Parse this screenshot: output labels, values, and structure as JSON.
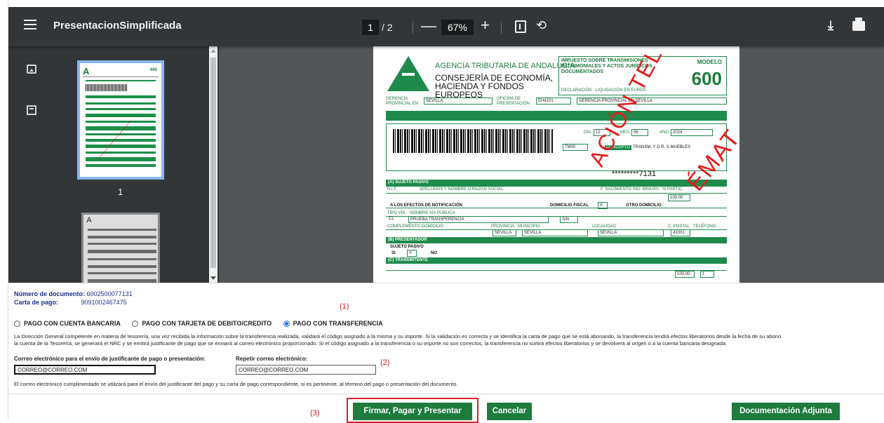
{
  "viewer": {
    "title": "PresentacionSimplificada",
    "page_current": "1",
    "page_total": "/ 2",
    "zoom": "67%",
    "minus": "—",
    "plus": "+",
    "rotate": "⟲",
    "download": "⤓",
    "thumb1_label": "1",
    "thumb_logo": "A",
    "thumb_model": "600"
  },
  "document": {
    "agency": "AGENCIA TRIBUTARIA DE ANDALUCÍA",
    "consejeria": "CONSEJERÍA DE ECONOMÍA, HACIENDA Y FONDOS EUROPEOS",
    "tax_title": "IMPUESTO SOBRE TRANSMISIONES PATRIMONIALES Y ACTOS JURÍDICOS DOCUMENTADOS",
    "modelo_label": "MODELO",
    "modelo": "600",
    "declaracion": "DECLARACIÓN - LIQUIDACIÓN EN EUROS",
    "gerencia_label": "GERENCIA PROVINCIAL EN",
    "gerencia": "SEVILLA",
    "oficina_label": "OFICINA DE PRESENTACIÓN",
    "oficina": "EH4101",
    "gerencia_desc": "GERENCIA PROVINCIAL EN SEVILLA",
    "dia_label": "DÍA",
    "dia": "12",
    "mes_label": "MES",
    "mes": "06",
    "anio_label": "AÑO",
    "anio": "2024",
    "tm": "TM00",
    "concepto_label": "CONCEPTO",
    "concepto": "TRANSM. Y D.R. S MUEBLES",
    "masked": "*********7131",
    "sec_a": "(A) SUJETO PASIVO",
    "nif_label": "N.I.F.",
    "apellidos_label": "APELLIDOS Y NOMBRE O RAZÓN SOCIAL",
    "nacimiento_label": "F. NACIMIENTO",
    "minusv_label": "IND. MINUSV.",
    "partic_label": "% PARTIC.",
    "partic": "100,00",
    "notif_label": "A LOS EFECTOS DE NOTIFICACIÓN",
    "domfiscal_label": "DOMICILIO FISCAL",
    "domfiscal": "X",
    "otrodom_label": "OTRO DOMICILIO",
    "tipovia_label": "TIPO VÍA",
    "tipovia": "CL",
    "via_label": "NOMBRE VÍA PÚBLICA",
    "via": "PRUEBA TRANSFERENCIA",
    "numero": "S/N",
    "complemento_label": "COMPLEMENTO DOMICILIO",
    "provincia_label": "PROVINCIA",
    "provincia": "SEVILLA",
    "municipio_label": "MUNICIPIO",
    "municipio": "SEVILLA",
    "localidad_label": "LOCALIDAD",
    "localidad": "SEVILLA",
    "cpostal_label": "C. POSTAL",
    "cpostal": "41001",
    "telefono_label": "TELÉFONO",
    "sec_b": "(B) PRESENTADOR",
    "sujeto_pasivo": "SUJETO PASIVO",
    "si": "SI",
    "si_val": "X",
    "no": "NO",
    "sec_c": "(C) TRANSMITENTE",
    "partic2": "100,00",
    "transmit": "1",
    "stamp1": "ACIÓN TEL",
    "stamp2": "ÉMAT"
  },
  "form": {
    "doc_num_label": "Número de documento:",
    "doc_num": "6002500077131",
    "carta_label": "Carta de pago:",
    "carta": "9091002467475",
    "ann1": "(1)",
    "ann2": "(2)",
    "ann3": "(3)",
    "radio1": "PAGO CON CUENTA BANCARIA",
    "radio2": "PAGO CON TARJETA DE DEBITO/CREDITO",
    "radio3": "PAGO CON TRANSFERENCIA",
    "selected_radio": "PAGO CON TRANSFERENCIA",
    "para1": "La Dirección General competente en materia de tesorería, una vez recibida la información sobre la transferencia realizada, validará el código asignado a la misma y su importe. Si la validación es correcta y se identifica la carta de pago que se está abonando, la transferencia tendrá efectos liberatorios desde la fecha de su abono",
    "para2": "la cuenta de la Tesorería, se generará el NRC y se emitirá justificante de pago que se enviará al correo electrónico proporcionado. Si el código asignado a la transferencia o su importe no son correctos, la transferencia no surtirá efectos liberatorios y se devolverá al origen o a la cuenta bancaria designada.",
    "email_label": "Correo electrónico para el envío de justificante de pago o presentación:",
    "email_value": "CORREO@CORREO.COM",
    "email2_label": "Repetir correo electrónico:",
    "email2_value": "CORREO@CORREO.COM",
    "note": "El correo electrónico cumplimentado se utilizará para el envío del justificante del pago y su carta de pago correspondiente, si es pertinente, al término del pago o presentación del documento.",
    "btn_sign": "Firmar, Pagar y Presentar",
    "btn_cancel": "Cancelar",
    "btn_docs": "Documentación Adjunta"
  },
  "colors": {
    "accent_green": "#1e7b3c",
    "annotation_red": "#d01e1e",
    "viewer_toolbar": "#323639",
    "viewer_bg": "#525659"
  }
}
